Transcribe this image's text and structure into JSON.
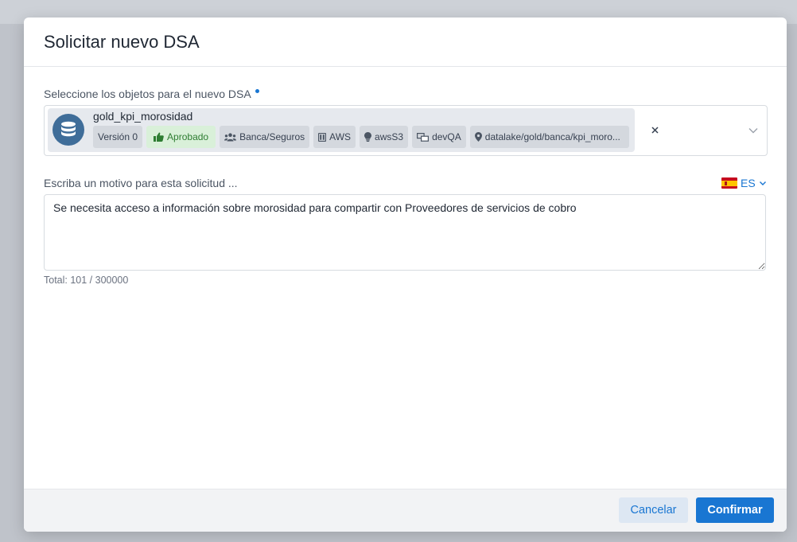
{
  "modal": {
    "title": "Solicitar nuevo DSA",
    "objects_label": "Seleccione los objetos para el nuevo DSA",
    "selected_object": {
      "name": "gold_kpi_morosidad",
      "icon": "database-icon",
      "tags": {
        "version": "Versión 0",
        "status": "Aprobado",
        "domain": "Banca/Seguros",
        "provider": "AWS",
        "technology": "awsS3",
        "environment": "devQA",
        "path": "datalake/gold/banca/kpi_moro..."
      }
    },
    "reason_label": "Escriba un motivo para esta solicitud ...",
    "language": "ES",
    "reason_text": "Se necesita acceso a información sobre morosidad para compartir con Proveedores de servicios de cobro",
    "counter": "Total: 101 / 300000"
  },
  "footer": {
    "cancel_label": "Cancelar",
    "confirm_label": "Confirmar"
  },
  "colors": {
    "accent": "#1976d2",
    "approved_bg": "#d9f0d9",
    "approved_text": "#2e7d32",
    "db_icon_bg": "#3f6d99"
  }
}
